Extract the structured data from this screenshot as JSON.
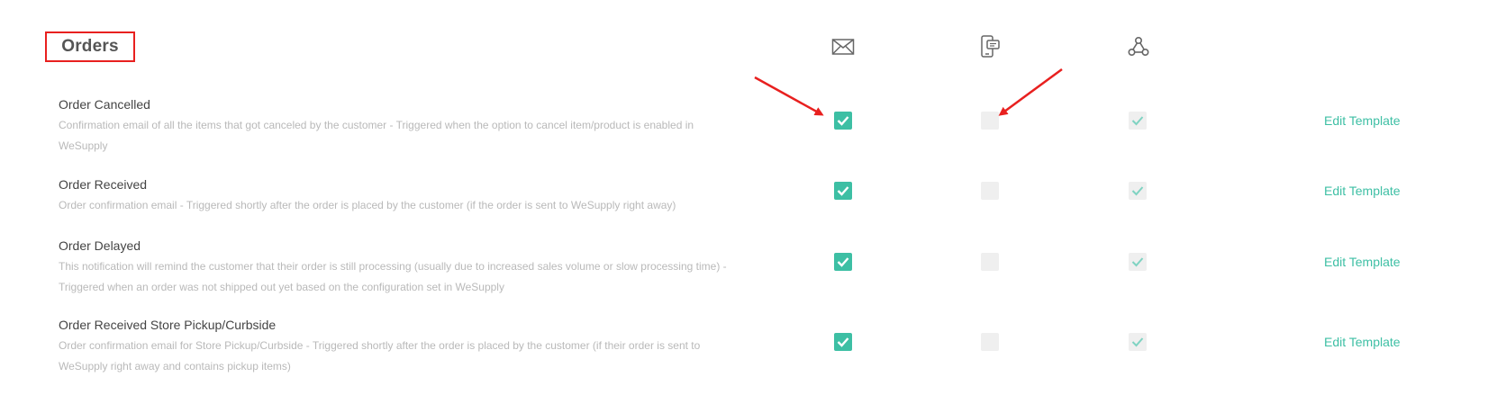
{
  "section": {
    "title": "Orders"
  },
  "columns": [
    {
      "icon": "email-envelope-icon"
    },
    {
      "icon": "sms-phone-icon"
    },
    {
      "icon": "webhook-icon"
    }
  ],
  "rows": [
    {
      "title": "Order Cancelled",
      "desc": "Confirmation email of all the items that got canceled by the customer - Triggered when the option to cancel item/product is enabled in WeSupply",
      "email": true,
      "sms": false,
      "webhook": true,
      "edit": "Edit Template"
    },
    {
      "title": "Order Received",
      "desc": "Order confirmation email - Triggered shortly after the order is placed by the customer (if the order is sent to WeSupply right away)",
      "email": true,
      "sms": false,
      "webhook": true,
      "edit": "Edit Template"
    },
    {
      "title": "Order Delayed",
      "desc": "This notification will remind the customer that their order is still processing (usually due to increased sales volume or slow processing time) - Triggered when an order was not shipped out yet based on the configuration set in WeSupply",
      "email": true,
      "sms": false,
      "webhook": true,
      "edit": "Edit Template"
    },
    {
      "title": "Order Received Store Pickup/Curbside",
      "desc": "Order confirmation email for Store Pickup/Curbside - Triggered shortly after the order is placed by the customer (if their order is sent to WeSupply right away and contains pickup items)",
      "email": true,
      "sms": false,
      "webhook": true,
      "edit": "Edit Template"
    }
  ],
  "colors": {
    "accent": "#3dbfa4",
    "annotation": "#e8201f",
    "checkbox_off": "#efefef",
    "webhook_check": "#7fd3c2"
  }
}
